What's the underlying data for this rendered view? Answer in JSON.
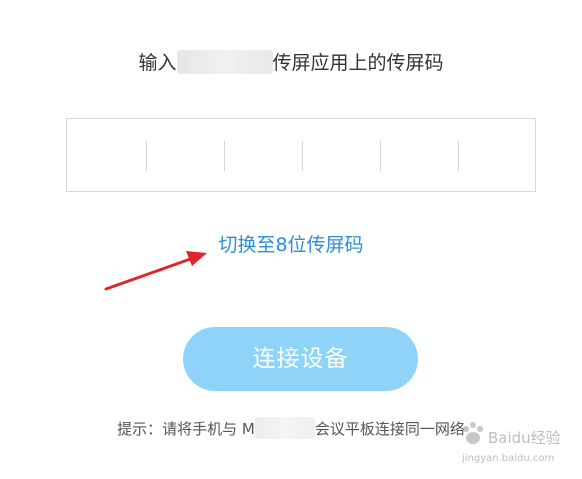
{
  "instruction": {
    "prefix": "输入",
    "suffix": "传屏应用上的传屏码"
  },
  "code_input": {
    "cell_count": 6
  },
  "switch_link": {
    "label": "切换至8位传屏码"
  },
  "connect_button": {
    "label": "连接设备"
  },
  "hint": {
    "prefix": "提示：请将手机与 M",
    "suffix": "会议平板连接同一网络"
  },
  "watermark": {
    "brand": "Baidu经验",
    "url": "jingyan.baidu.com"
  },
  "colors": {
    "link": "#2a8fd7",
    "button_bg": "#8fd3f8",
    "annotation_arrow": "#e0262b"
  }
}
